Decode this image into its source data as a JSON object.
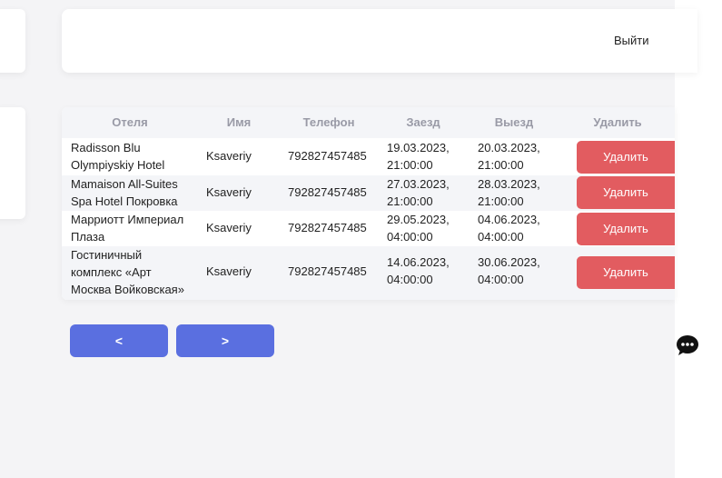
{
  "header": {
    "logout_label": "Выйти"
  },
  "table": {
    "columns": {
      "hotel": "Отеля",
      "name": "Имя",
      "phone": "Телефон",
      "checkin": "Заезд",
      "checkout": "Выезд",
      "delete": "Удалить"
    },
    "rows": [
      {
        "hotel_line1": "Radisson Blu",
        "hotel_line2": "Olympiyskiy Hotel",
        "hotel_line3": "",
        "name": "Ksaveriy",
        "phone": "792827457485",
        "checkin_date": "19.03.2023,",
        "checkin_time": "21:00:00",
        "checkout_date": "20.03.2023,",
        "checkout_time": "21:00:00",
        "delete_label": "Удалить"
      },
      {
        "hotel_line1": "Mamaison All-Suites",
        "hotel_line2": "Spa Hotel Покровка",
        "hotel_line3": "",
        "name": "Ksaveriy",
        "phone": "792827457485",
        "checkin_date": "27.03.2023,",
        "checkin_time": "21:00:00",
        "checkout_date": "28.03.2023,",
        "checkout_time": "21:00:00",
        "delete_label": "Удалить"
      },
      {
        "hotel_line1": "Марриотт Империал",
        "hotel_line2": "Плаза",
        "hotel_line3": "",
        "name": "Ksaveriy",
        "phone": "792827457485",
        "checkin_date": "29.05.2023,",
        "checkin_time": "04:00:00",
        "checkout_date": "04.06.2023,",
        "checkout_time": "04:00:00",
        "delete_label": "Удалить"
      },
      {
        "hotel_line1": "Гостиничный",
        "hotel_line2": "комплекс «Арт",
        "hotel_line3": "Москва Войковская»",
        "name": "Ksaveriy",
        "phone": "792827457485",
        "checkin_date": "14.06.2023,",
        "checkin_time": "04:00:00",
        "checkout_date": "30.06.2023,",
        "checkout_time": "04:00:00",
        "delete_label": "Удалить"
      }
    ]
  },
  "pagination": {
    "prev_label": "<",
    "next_label": ">"
  },
  "chat": {
    "icon": "chat-bubble-icon"
  }
}
